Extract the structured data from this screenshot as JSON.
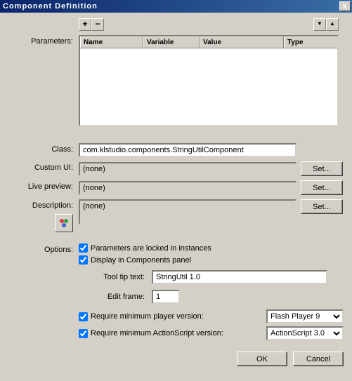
{
  "window": {
    "title": "Component Definition",
    "close": "X"
  },
  "toolbar": {
    "add": "+",
    "remove": "−",
    "down": "▼",
    "up": "▲"
  },
  "labels": {
    "parameters": "Parameters:",
    "class": "Class:",
    "custom_ui": "Custom UI:",
    "live_preview": "Live preview:",
    "description": "Description:",
    "options": "Options:",
    "tooltip": "Tool tip text:",
    "edit_frame": "Edit frame:"
  },
  "table": {
    "headers": {
      "name": "Name",
      "variable": "Variable",
      "value": "Value",
      "type": "Type"
    }
  },
  "fields": {
    "class": "com.klstudio.components.StringUtilComponent",
    "custom_ui": "(none)",
    "live_preview": "(none)",
    "description": "(none)",
    "tooltip": "StringUtil 1.0",
    "edit_frame": "1"
  },
  "buttons": {
    "set": "Set...",
    "ok": "OK",
    "cancel": "Cancel"
  },
  "options": {
    "locked": "Parameters are locked in instances",
    "display_panel": "Display in Components panel",
    "req_player": "Require minimum player version:",
    "req_as": "Require minimum ActionScript version:"
  },
  "selects": {
    "player": "Flash Player 9",
    "as": "ActionScript 3.0"
  },
  "checked": {
    "locked": true,
    "display_panel": true,
    "req_player": true,
    "req_as": true
  }
}
